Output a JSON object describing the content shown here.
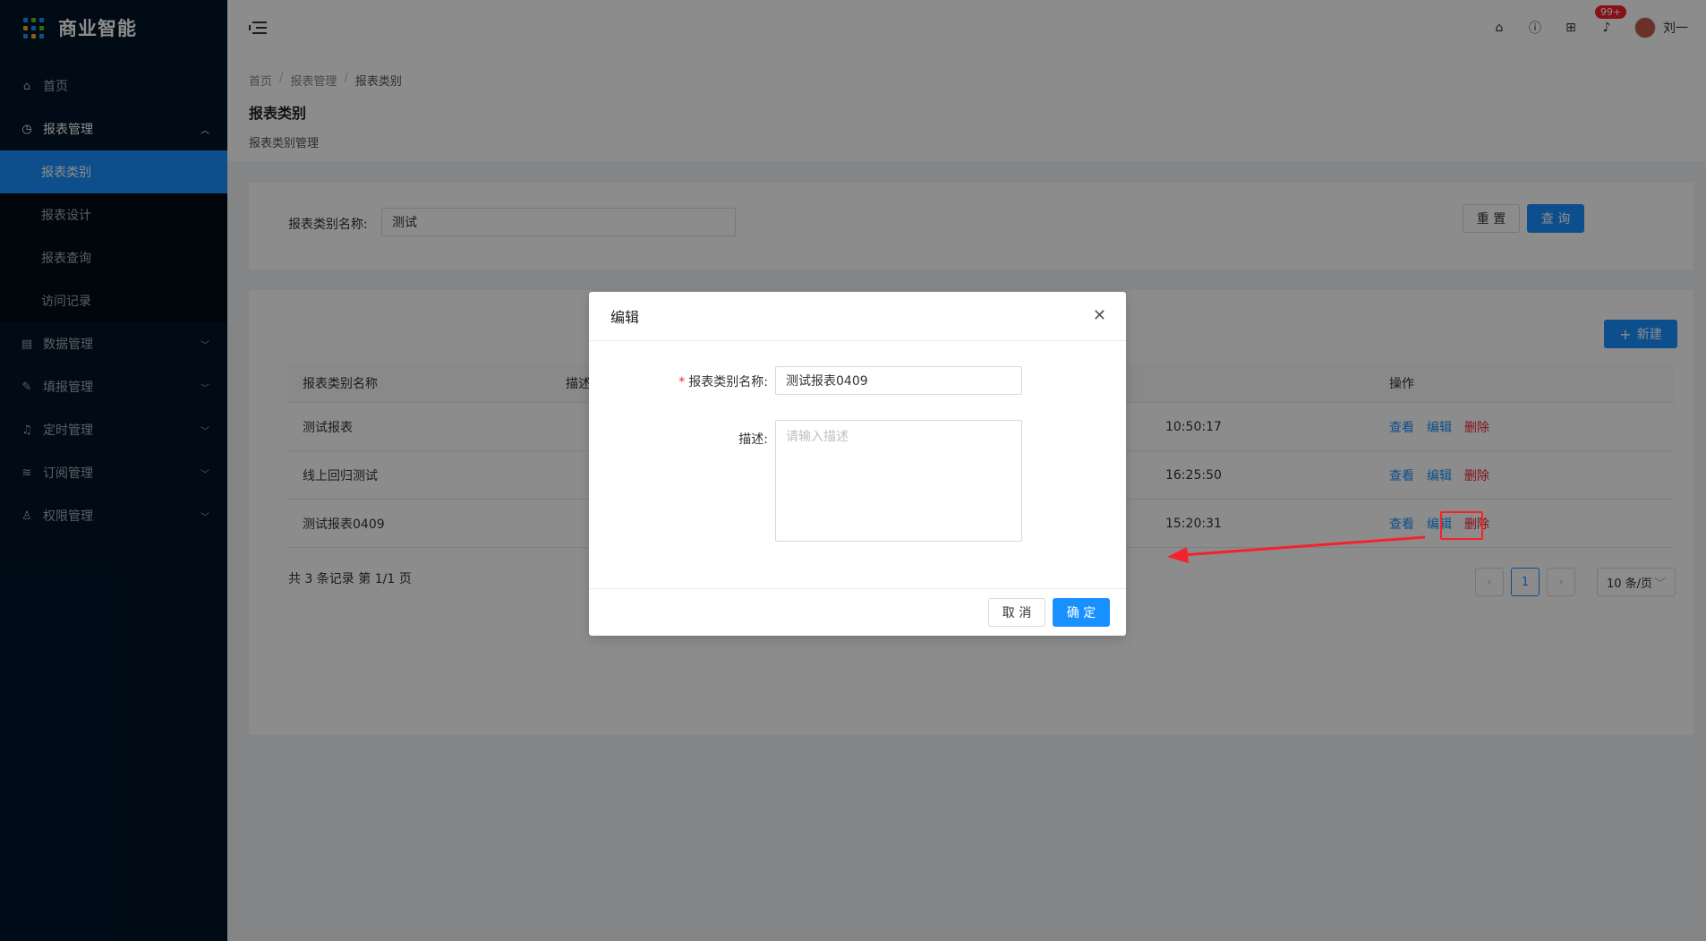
{
  "app": {
    "title": "商业智能"
  },
  "sidebar": {
    "items": [
      {
        "label": "首页",
        "icon": "home-icon"
      },
      {
        "label": "报表管理",
        "icon": "dashboard-icon",
        "open": true
      },
      {
        "label": "数据管理",
        "icon": "database-icon"
      },
      {
        "label": "填报管理",
        "icon": "edit-form-icon"
      },
      {
        "label": "定时管理",
        "icon": "bell-icon"
      },
      {
        "label": "订阅管理",
        "icon": "wifi-icon"
      },
      {
        "label": "权限管理",
        "icon": "user-icon"
      }
    ],
    "sub_items": [
      {
        "label": "报表类别",
        "active": true
      },
      {
        "label": "报表设计"
      },
      {
        "label": "报表查询"
      },
      {
        "label": "访问记录"
      }
    ]
  },
  "header": {
    "notification_badge": "99+",
    "user_name": "刘一",
    "icons": [
      "home-icon",
      "help-icon",
      "apps-icon",
      "bell-icon"
    ]
  },
  "breadcrumb": [
    "首页",
    "报表管理",
    "报表类别"
  ],
  "page": {
    "title": "报表类别",
    "subtitle": "报表类别管理"
  },
  "search": {
    "label": "报表类别名称:",
    "value": "测试",
    "reset_label": "重 置",
    "query_label": "查 询"
  },
  "table": {
    "new_label": "新建",
    "columns": {
      "name": "报表类别名称",
      "desc": "描述",
      "ops": "操作"
    },
    "rows": [
      {
        "name": "测试报表",
        "time": "10:50:17"
      },
      {
        "name": "线上回归测试",
        "time": "16:25:50"
      },
      {
        "name": "测试报表0409",
        "time": "15:20:31"
      }
    ],
    "ops": {
      "view": "查看",
      "edit": "编辑",
      "delete": "删除"
    },
    "summary": "共 3 条记录 第 1/1 页",
    "page": "1",
    "page_size": "10 条/页"
  },
  "modal": {
    "title": "编辑",
    "name_label": "报表类别名称:",
    "name_value": "测试报表0409",
    "desc_label": "描述:",
    "desc_placeholder": "请输入描述",
    "cancel_label": "取 消",
    "ok_label": "确 定"
  },
  "colors": {
    "primary": "#1890ff",
    "danger": "#f5222d",
    "sidebar": "#001529"
  }
}
